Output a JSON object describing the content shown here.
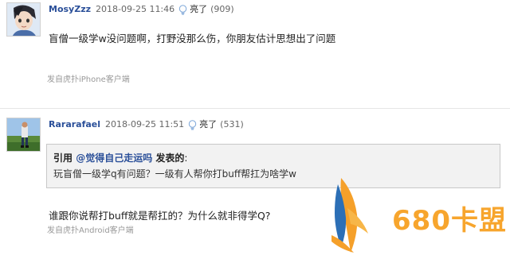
{
  "posts": [
    {
      "username": "MosyZzz",
      "timestamp": "2018-09-25 11:46",
      "light_label": "亮了",
      "light_count": "(909)",
      "text": "盲僧一级学w没问题啊，打野没那么伤，你朋友估计思想出了问题",
      "source": "发自虎扑iPhone客户端"
    },
    {
      "username": "Rararafael",
      "timestamp": "2018-09-25 11:51",
      "light_label": "亮了",
      "light_count": "(531)",
      "quote": {
        "label": "引用 ",
        "user": "@觉得自己走运吗",
        "said": " 发表的",
        "colon": ":",
        "text": "玩盲僧一级学q有问题？一级有人帮你打buff帮扛为啥学w"
      },
      "text": "谁跟你说帮打buff就是帮扛的？为什么就非得学Q?",
      "source": "发自虎扑Android客户端"
    }
  ],
  "watermark": {
    "text": "680卡盟"
  },
  "icons": {
    "light": "lightbulb-icon"
  },
  "colors": {
    "username": "#2a4f99",
    "watermark": "#f7a52d",
    "source": "#999999"
  }
}
